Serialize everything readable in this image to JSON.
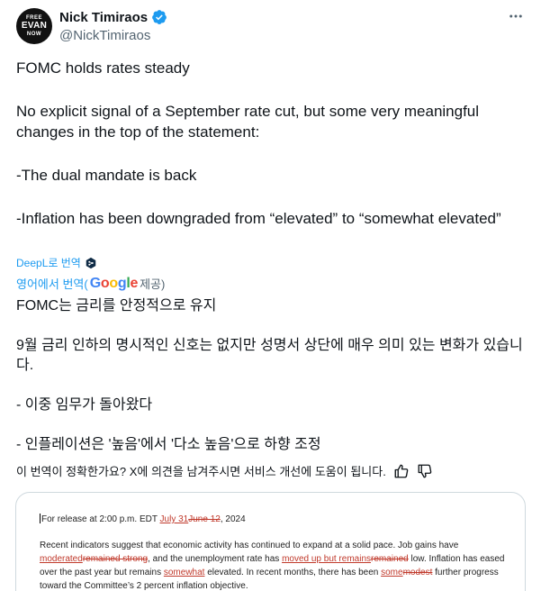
{
  "author": {
    "avatar_text": [
      "FREE",
      "EVAN",
      "NOW"
    ],
    "display_name": "Nick Timiraos",
    "handle": "@NickTimiraos",
    "verified_color": "#1d9bf0"
  },
  "tweet": {
    "lines": [
      "FOMC holds rates steady",
      "No explicit signal of a September rate cut, but some very meaningful changes in the top of the statement:",
      "-The dual mandate is back",
      "-Inflation has been downgraded from “elevated” to “somewhat elevated”"
    ]
  },
  "translation": {
    "deepl_label": "DeepL로 번역",
    "google_prefix": "영어에서 번역(",
    "google_word": "Google",
    "google_suffix": " 제공)",
    "lines": [
      "FOMC는 금리를 안정적으로 유지",
      "9월 금리 인하의 명시적인 신호는 없지만 성명서 상단에 매우 의미 있는 변화가 있습니다.",
      "- 이중 임무가 돌아왔다",
      "- 인플레이션은 '높음'에서 '다소 높음'으로 하향 조정"
    ],
    "feedback_text": "이 번역이 정확한가요? X에 의견을 남겨주시면 서비스 개선에 도움이 됩니다."
  },
  "document": {
    "release_prefix": "For release at 2:00 p.m. EDT ",
    "release_inserted": "July 31",
    "release_deleted": "June 12",
    "release_suffix": ", 2024",
    "p1_a": "Recent indicators suggest that economic activity has continued to expand at a solid pace. Job gains have ",
    "p1_ins1": "moderated",
    "p1_del1": "remained strong",
    "p1_b": ", and the unemployment rate has ",
    "p1_ins2": "moved up but remains",
    "p1_del2": "remained",
    "p1_c": " low. Inflation has eased over the past year but remains ",
    "p1_ins3": "somewhat",
    "p1_d": " elevated. In recent months, there has been ",
    "p1_ins4": "some",
    "p1_del4": "modest",
    "p1_e": " further progress toward the Committee’s 2 percent inflation objective."
  },
  "colors": {
    "link": "#1d9bf0",
    "redline": "#c0392b",
    "text": "#0f1419",
    "secondary": "#536471"
  }
}
